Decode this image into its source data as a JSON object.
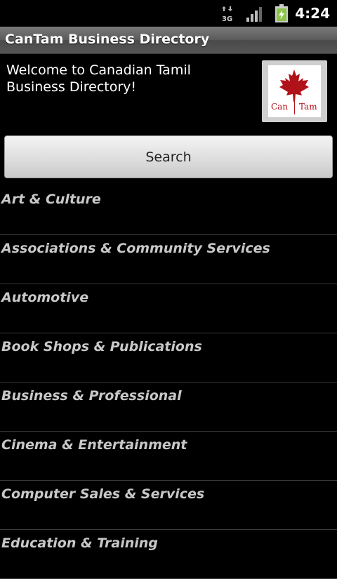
{
  "status_bar": {
    "network_type": "3G",
    "time": "4:24",
    "icons": [
      "network-3g-icon",
      "signal-strength-icon",
      "battery-charging-icon"
    ],
    "battery_color": "#8bc34a"
  },
  "app": {
    "title": "CanTam Business Directory"
  },
  "header": {
    "welcome_text": "Welcome to Canadian Tamil Business Directory!",
    "logo": {
      "left_text": "Can",
      "right_text": "Tam",
      "icon": "maple-leaf-icon",
      "color": "#b0121a"
    }
  },
  "search": {
    "label": "Search"
  },
  "categories": [
    {
      "label": "Art & Culture"
    },
    {
      "label": "Associations & Community Services"
    },
    {
      "label": "Automotive"
    },
    {
      "label": "Book Shops & Publications"
    },
    {
      "label": "Business & Professional"
    },
    {
      "label": "Cinema & Entertainment"
    },
    {
      "label": "Computer Sales & Services"
    },
    {
      "label": "Education & Training"
    }
  ]
}
